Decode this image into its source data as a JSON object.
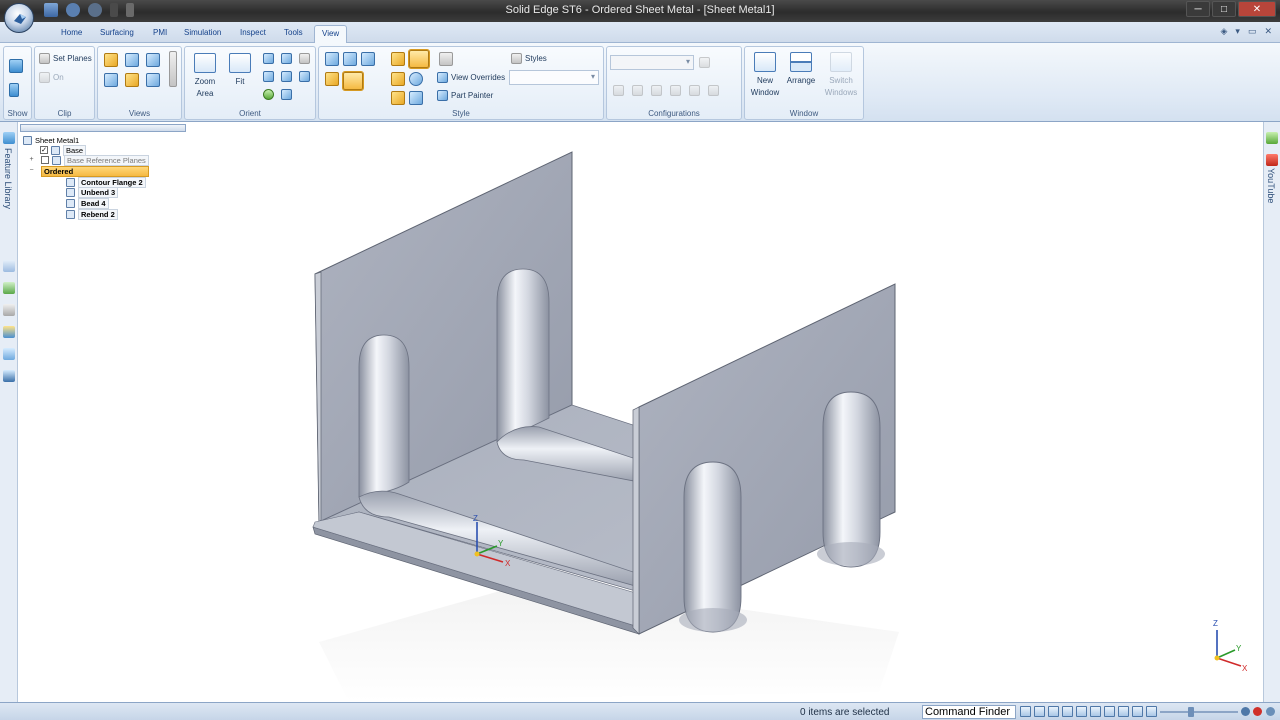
{
  "window": {
    "title": "Solid Edge ST6 - Ordered Sheet Metal - [Sheet Metal1]",
    "controls": [
      "─",
      "□",
      "✕"
    ]
  },
  "tabs": [
    {
      "label": "Home"
    },
    {
      "label": "Surfacing"
    },
    {
      "label": "PMI"
    },
    {
      "label": "Simulation"
    },
    {
      "label": "Inspect"
    },
    {
      "label": "Tools"
    },
    {
      "label": "View",
      "active": true
    }
  ],
  "ribbon": {
    "show": {
      "label": "Show"
    },
    "clip": {
      "label": "Clip",
      "set_planes": "Set Planes",
      "on": "On"
    },
    "views": {
      "label": "Views"
    },
    "orient": {
      "label": "Orient",
      "zoom_area": "Zoom Area",
      "fit": "Fit"
    },
    "style": {
      "label": "Style",
      "styles": "Styles",
      "view_overrides": "View Overrides",
      "part_painter": "Part Painter"
    },
    "configurations": {
      "label": "Configurations"
    },
    "window": {
      "label": "Window",
      "new_window": "New Window",
      "arrange": "Arrange",
      "switch_windows": "Switch Windows"
    }
  },
  "pathfinder": {
    "items": [
      {
        "label": "Sheet Metal1",
        "icon": "part-icon"
      },
      {
        "label": "Base",
        "checked": true
      },
      {
        "label": "Base Reference Planes",
        "checked": false,
        "expander": "+"
      },
      {
        "label": "Ordered",
        "expander": "−",
        "selected": true
      },
      {
        "label": "Contour Flange 2"
      },
      {
        "label": "Unbend 3"
      },
      {
        "label": "Bead 4"
      },
      {
        "label": "Rebend 2"
      }
    ]
  },
  "left_dock": {
    "feature_library": "Feature Library"
  },
  "right_dock": {
    "youtube": "YouTube"
  },
  "triad": {
    "z": "Z",
    "y": "Y",
    "x": "X"
  },
  "status": {
    "message": "0 items are selected",
    "command_finder": "Command Finder"
  },
  "colors": {
    "part_face": "#9ea4b3",
    "part_face_light": "#b9bfcc",
    "selected_feature": "#f5b942",
    "accent": "#15428b"
  }
}
